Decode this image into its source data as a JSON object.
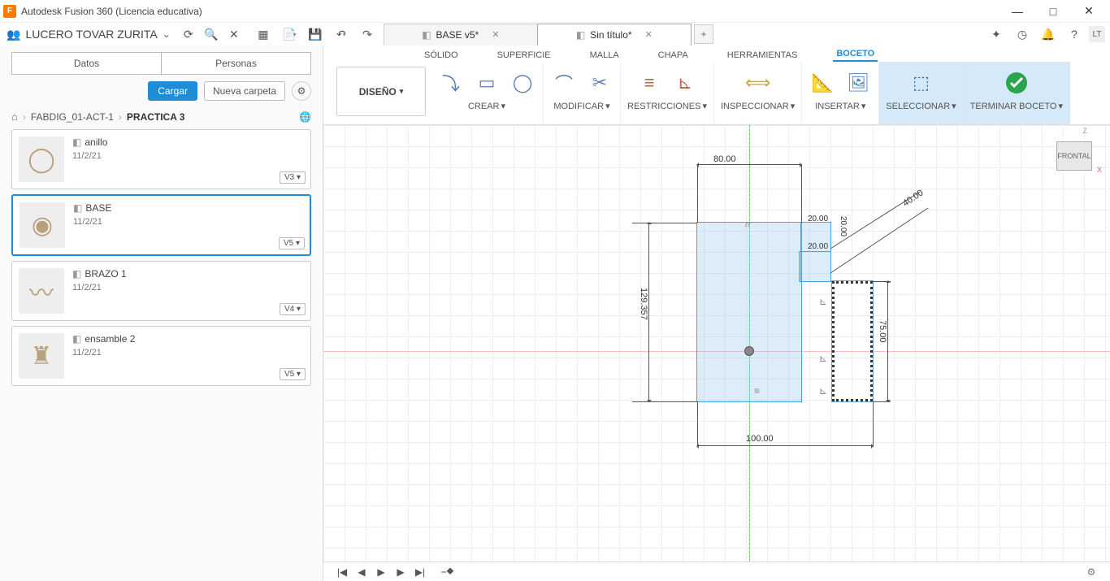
{
  "app": {
    "title": "Autodesk Fusion 360 (Licencia educativa)",
    "user": "LUCERO TOVAR ZURITA"
  },
  "document_tabs": [
    {
      "label": "BASE v5*",
      "active": false
    },
    {
      "label": "Sin título*",
      "active": true
    }
  ],
  "top_right_avatar": "LT",
  "left_panel": {
    "tabs": {
      "data": "Datos",
      "people": "Personas"
    },
    "upload": "Cargar",
    "new_folder": "Nueva carpeta",
    "breadcrumb": [
      {
        "label": "FABDIG_01-ACT-1",
        "strong": false
      },
      {
        "label": "PRACTICA 3",
        "strong": true
      }
    ],
    "files": [
      {
        "name": "anillo",
        "date": "11/2/21",
        "version": "V3",
        "selected": false
      },
      {
        "name": "BASE",
        "date": "11/2/21",
        "version": "V5",
        "selected": true
      },
      {
        "name": "BRAZO 1",
        "date": "11/2/21",
        "version": "V4",
        "selected": false
      },
      {
        "name": "ensamble 2",
        "date": "11/2/21",
        "version": "V5",
        "selected": false
      }
    ]
  },
  "workspace_tabs": [
    {
      "label": "SÓLIDO",
      "active": false
    },
    {
      "label": "SUPERFICIE",
      "active": false
    },
    {
      "label": "MALLA",
      "active": false
    },
    {
      "label": "CHAPA",
      "active": false
    },
    {
      "label": "HERRAMIENTAS",
      "active": false
    },
    {
      "label": "BOCETO",
      "active": true
    }
  ],
  "ribbon": {
    "design_menu": "DISEÑO",
    "groups": [
      {
        "label": "CREAR",
        "dropdown": true
      },
      {
        "label": "MODIFICAR",
        "dropdown": true
      },
      {
        "label": "RESTRICCIONES",
        "dropdown": true
      },
      {
        "label": "INSPECCIONAR",
        "dropdown": true
      },
      {
        "label": "INSERTAR",
        "dropdown": true
      },
      {
        "label": "SELECCIONAR",
        "dropdown": true
      },
      {
        "label": "TERMINAR BOCETO",
        "dropdown": true
      }
    ]
  },
  "dimensions": {
    "d80": "80.00",
    "d100": "100.00",
    "d129": "129.357",
    "d75": "75.00",
    "d40": "40.00",
    "d20a": "20.00",
    "d20b": "20.00",
    "d20c": "20.00"
  },
  "viewcube": {
    "face": "FRONTAL",
    "z": "Z",
    "x": "X"
  }
}
